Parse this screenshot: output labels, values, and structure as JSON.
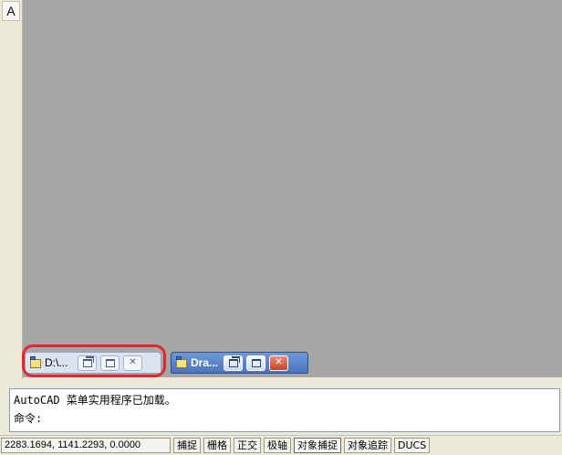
{
  "left_toolbar": {
    "text_tool_label": "A"
  },
  "mdi": {
    "windows": [
      {
        "title": "D:\\...",
        "active": false
      },
      {
        "title": "Dra...",
        "active": true
      }
    ],
    "restore_symbol": "⧉",
    "maximize_symbol": "□",
    "close_symbol": "✕"
  },
  "command_window": {
    "history_line": "AutoCAD 菜单实用程序已加载。",
    "prompt": "命令:"
  },
  "status_bar": {
    "coordinates": "2283.1694, 1141.2293, 0.0000",
    "toggles": [
      {
        "label": "捕捉",
        "on": false
      },
      {
        "label": "栅格",
        "on": false
      },
      {
        "label": "正交",
        "on": false
      },
      {
        "label": "极轴",
        "on": false
      },
      {
        "label": "对象捕捉",
        "on": true
      },
      {
        "label": "对象追踪",
        "on": false
      },
      {
        "label": "DUCS",
        "on": false
      }
    ]
  },
  "colors": {
    "workspace": "#a6a6a6",
    "highlight_ring": "#e2272d",
    "active_title": "#4a74c0"
  }
}
